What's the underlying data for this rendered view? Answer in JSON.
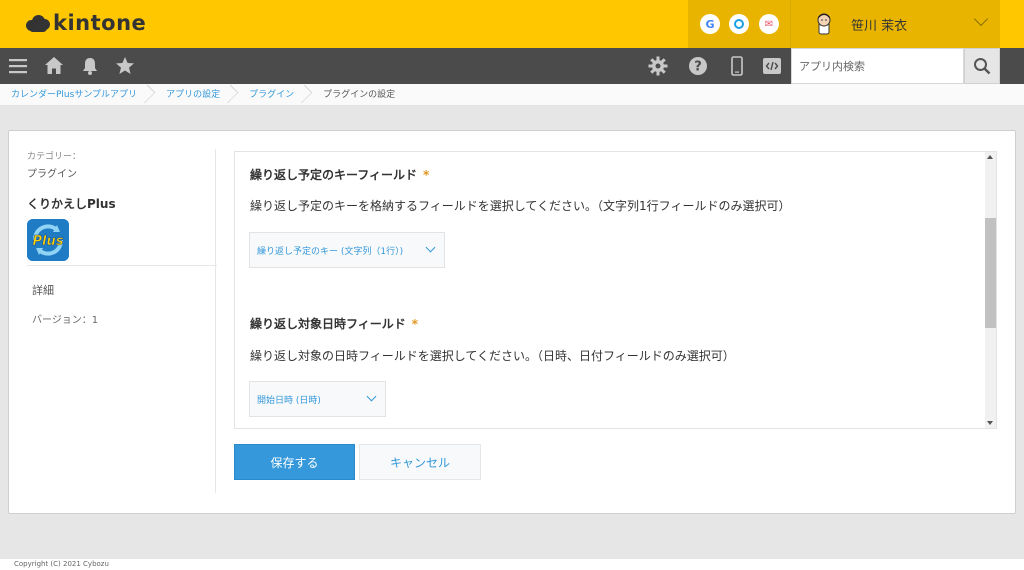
{
  "header": {
    "logo_text": "kintone",
    "services": [
      {
        "icon": "google-icon",
        "glyph": "G",
        "color": "#4285f4"
      },
      {
        "icon": "garoon-icon",
        "glyph": "O",
        "color": "#1ba1e2"
      },
      {
        "icon": "mail-icon",
        "glyph": "✉",
        "color": "#e9546b"
      }
    ],
    "user_name": "笹川 茉衣"
  },
  "toolbar": {
    "search_placeholder": "アプリ内検索"
  },
  "breadcrumb": [
    {
      "label": "カレンダーPlusサンプルアプリ",
      "link": true
    },
    {
      "label": "アプリの設定",
      "link": true
    },
    {
      "label": "プラグイン",
      "link": true
    },
    {
      "label": "プラグインの設定",
      "link": false
    }
  ],
  "sidebar": {
    "category_label": "カテゴリー：",
    "category_value": "プラグイン",
    "plugin_name": "くりかえしPlus",
    "plugin_icon_text": "Plus",
    "detail_label": "詳細",
    "version_label": "バージョン：1"
  },
  "settings": {
    "key_field": {
      "title": "繰り返し予定のキーフィールド",
      "required_mark": "*",
      "description": "繰り返し予定のキーを格納するフィールドを選択してください。（文字列1行フィールドのみ選択可）",
      "selected": "繰り返し予定のキー (文字列（1行）)"
    },
    "datetime_field": {
      "title": "繰り返し対象日時フィールド",
      "required_mark": "*",
      "description": "繰り返し対象の日時フィールドを選択してください。（日時、日付フィールドのみ選択可）",
      "selected": "開始日時 (日時)"
    }
  },
  "buttons": {
    "save": "保存する",
    "cancel": "キャンセル"
  },
  "footer": {
    "copyright": "Copyright (C) 2021 Cybozu"
  },
  "colors": {
    "header": "#ffc700",
    "toolbar": "#4b4b4b",
    "accent": "#3498db",
    "required": "#e49722"
  }
}
